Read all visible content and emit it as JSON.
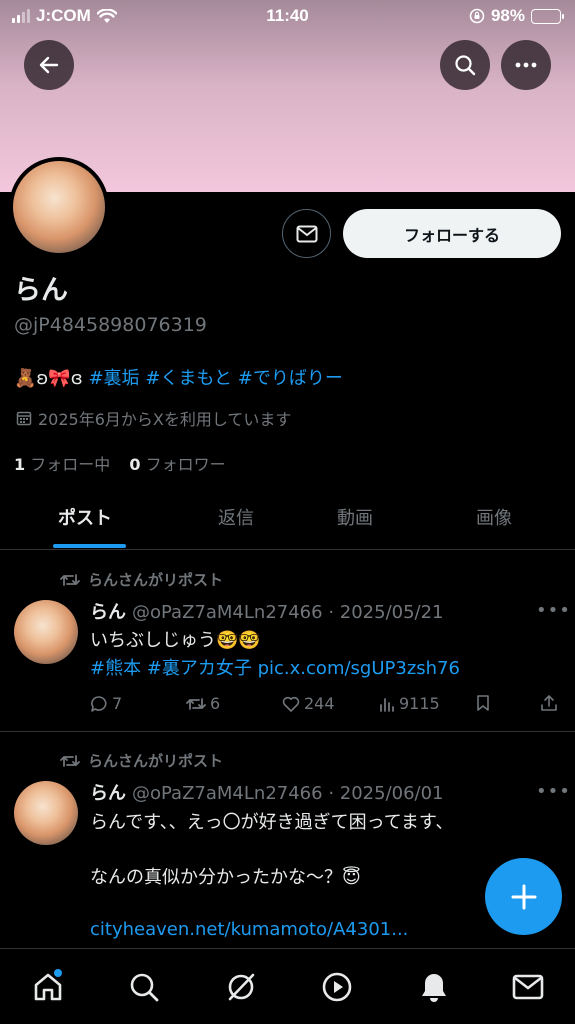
{
  "status_bar": {
    "carrier": "J:COM",
    "time": "11:40",
    "battery": "98%",
    "battery_level": 0.98
  },
  "header": {
    "back_icon": "arrow-left-icon",
    "search_icon": "search-icon",
    "more_icon": "more-horizontal-icon"
  },
  "profile": {
    "display_name": "らん",
    "handle": "@jP4845898076319",
    "bio_prefix": "🧸ʚ🎀ɞ",
    "bio_tags": [
      "#裏垢",
      "#くまもと",
      "#でりばりー"
    ],
    "joined": "2025年6月からXを利用しています",
    "following_count": "1",
    "following_label": "フォロー中",
    "followers_count": "0",
    "followers_label": "フォロワー",
    "follow_button": "フォローする"
  },
  "tabs": [
    {
      "label": "ポスト",
      "active": true
    },
    {
      "label": "返信",
      "active": false
    },
    {
      "label": "動画",
      "active": false
    },
    {
      "label": "画像",
      "active": false
    }
  ],
  "posts": [
    {
      "repost_label": "らんさんがリポスト",
      "name": "らん",
      "handle": "@oPaZ7aM4Ln27466",
      "date": "2025/05/21",
      "line1": "いちぶしじゅう🤓🤓",
      "tags": " #熊本  #裏アカ女子 ",
      "link": "pic.x.com/sgUP3zsh76",
      "replies": "7",
      "reposts": "6",
      "likes": "244",
      "views": "9115"
    },
    {
      "repost_label": "らんさんがリポスト",
      "name": "らん",
      "handle": "@oPaZ7aM4Ln27466",
      "date": "2025/06/01",
      "line1": "らんです、、えっ〇が好き過ぎて困ってます、",
      "line2": "なんの真似か分かったかな〜？😇",
      "link": "cityheaven.net/kumamoto/A4301..."
    }
  ],
  "colors": {
    "accent": "#1d9bf0",
    "background": "#000000",
    "muted": "#71767b",
    "banner": "#f3c7dc"
  }
}
